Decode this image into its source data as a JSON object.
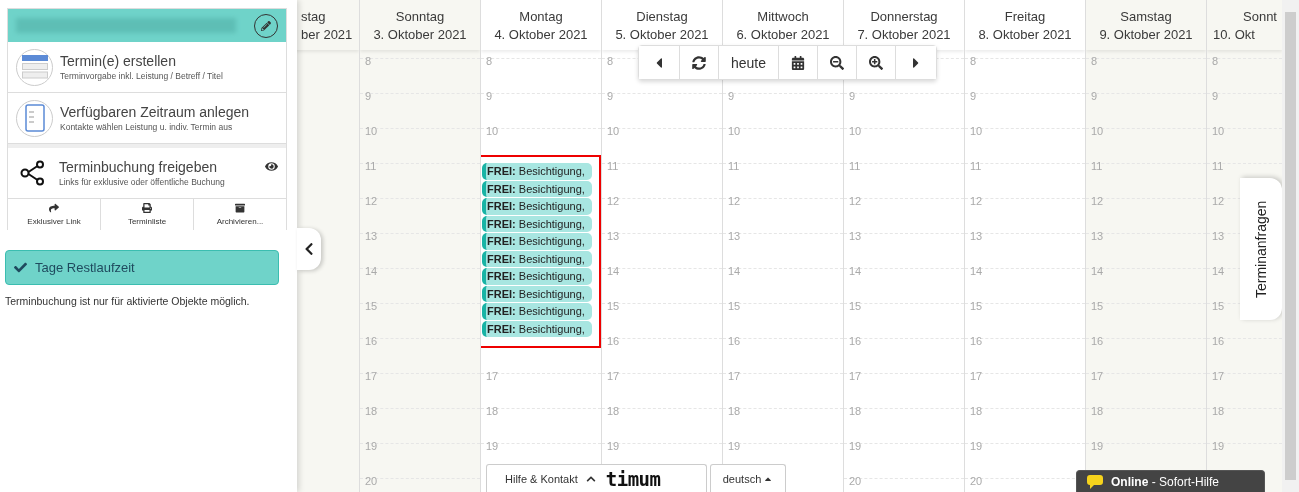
{
  "panel": {
    "actions": [
      {
        "kind": "create",
        "title": "Termin(e) erstellen",
        "subtitle": "Terminvorgabe inkl. Leistung / Betreff / Titel"
      },
      {
        "kind": "range",
        "title": "Verfügbaren Zeitraum anlegen",
        "subtitle": "Kontakte wählen Leistung u. indiv. Termin aus"
      }
    ],
    "share": {
      "title": "Terminbuchung freigeben",
      "subtitle": "Links für exklusive oder öffentliche Buchung"
    },
    "share_actions": [
      {
        "kind": "share",
        "label": "Exklusiver Link"
      },
      {
        "kind": "print",
        "label": "Terminliste"
      },
      {
        "kind": "archive",
        "label": "Archivieren..."
      }
    ],
    "status_button": "Tage Restlaufzeit",
    "note": "Terminbuchung ist nur für aktivierte Objekte möglich."
  },
  "toolbar": [
    {
      "kind": "prev"
    },
    {
      "kind": "refresh"
    },
    {
      "kind": "text",
      "label": "heute"
    },
    {
      "kind": "calendar"
    },
    {
      "kind": "zoom_out"
    },
    {
      "kind": "zoom_in"
    },
    {
      "kind": "next"
    }
  ],
  "calendar": {
    "columns": [
      {
        "kind": "cut_left",
        "day": "stag",
        "date": "ber 2021",
        "weekend": true
      },
      {
        "kind": "full",
        "day": "Sonntag",
        "date": "3. Oktober 2021",
        "weekend": true,
        "hours": [
          "8",
          "9",
          "10",
          "11",
          "12",
          "13",
          "14",
          "15",
          "16",
          "17",
          "18",
          "19",
          "20"
        ]
      },
      {
        "kind": "full",
        "day": "Montag",
        "date": "4. Oktober 2021",
        "weekend": false,
        "highlighted": true,
        "hours": [
          "8",
          "9",
          "10"
        ],
        "events": [
          {
            "text": "**FREI:** Besichtigung,"
          },
          {
            "text": "**FREI:** Besichtigung,"
          },
          {
            "text": "**FREI:** Besichtigung,"
          },
          {
            "text": "**FREI:** Besichtigung,"
          },
          {
            "text": "**FREI:** Besichtigung,"
          },
          {
            "text": "**FREI:** Besichtigung,"
          },
          {
            "text": "**FREI:** Besichtigung,"
          },
          {
            "text": "**FREI:** Besichtigung,"
          },
          {
            "text": "**FREI:** Besichtigung,"
          },
          {
            "text": "**FREI:** Besichtigung,"
          }
        ],
        "hours_after": [
          "17",
          "18",
          "19"
        ]
      },
      {
        "kind": "full",
        "day": "Dienstag",
        "date": "5. Oktober 2021",
        "weekend": false,
        "hours": [
          "8",
          "9",
          "10",
          "11",
          "12",
          "13",
          "14",
          "15",
          "16",
          "17",
          "18",
          "19"
        ]
      },
      {
        "kind": "full",
        "day": "Mittwoch",
        "date": "6. Oktober 2021",
        "weekend": false,
        "covered_by_toolbar": true,
        "hours": [
          "9",
          "10",
          "11",
          "12",
          "13",
          "14",
          "15",
          "16",
          "17",
          "18",
          "19"
        ]
      },
      {
        "kind": "full",
        "day": "Donnerstag",
        "date": "7. Oktober 2021",
        "weekend": false,
        "covered_by_toolbar": true,
        "hours": [
          "9",
          "10",
          "11",
          "12",
          "13",
          "14",
          "15",
          "16",
          "17",
          "18",
          "19",
          "20"
        ]
      },
      {
        "kind": "full",
        "day": "Freitag",
        "date": "8. Oktober 2021",
        "weekend": false,
        "hours": [
          "8",
          "9",
          "10",
          "11",
          "12",
          "13",
          "14",
          "15",
          "16",
          "17",
          "18",
          "19",
          "20"
        ]
      },
      {
        "kind": "full",
        "day": "Samstag",
        "date": "9. Oktober 2021",
        "weekend": true,
        "hours": [
          "8",
          "9",
          "10",
          "11",
          "12",
          "13",
          "14",
          "15",
          "16",
          "17",
          "18",
          "19"
        ]
      },
      {
        "kind": "cut_right",
        "day": "Sonnt",
        "date": "10. Okt",
        "weekend": true,
        "hours": [
          "8",
          "9",
          "10",
          "11",
          "12",
          "13",
          "14",
          "15",
          "16",
          "17",
          "18",
          "19"
        ]
      }
    ]
  },
  "side_tab": "Terminanfragen",
  "help": {
    "label": "Hilfe & Kontakt",
    "logo": "timum",
    "language": "deutsch"
  },
  "chat": {
    "text": "**Online** - Sofort-Hilfe"
  }
}
